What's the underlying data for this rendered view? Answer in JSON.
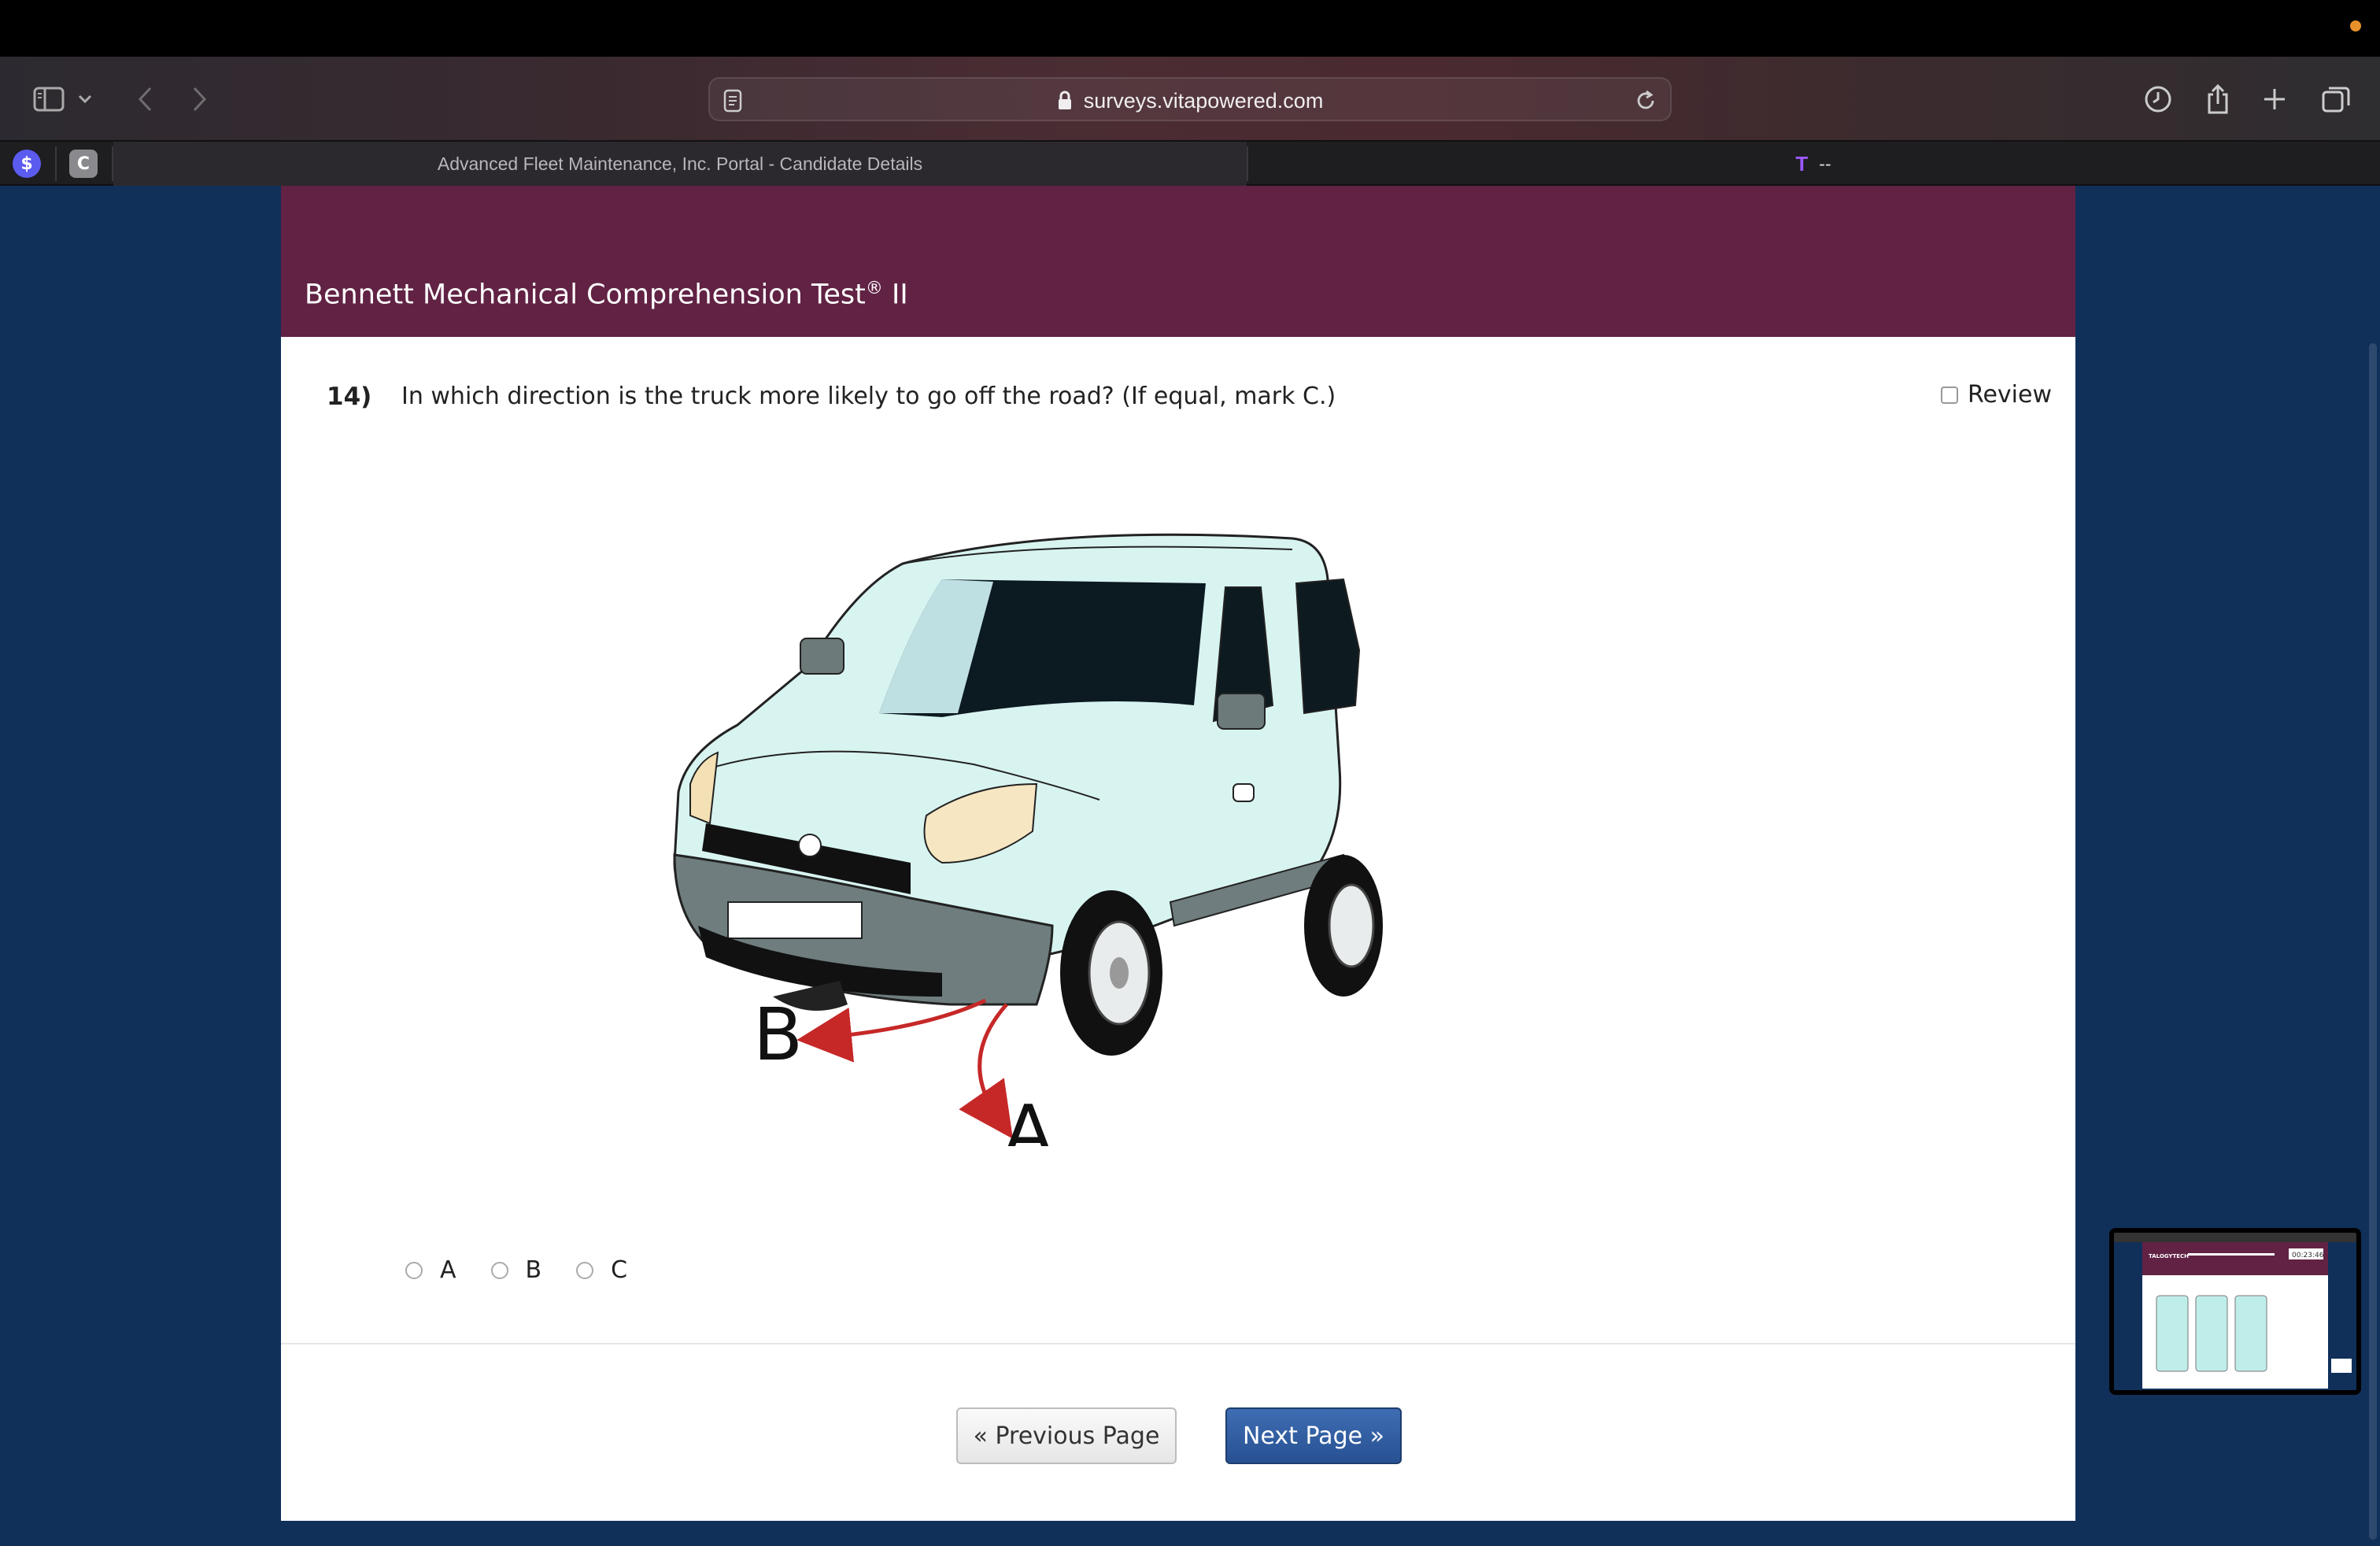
{
  "browser": {
    "url": "surveys.vitapowered.com",
    "tabs": [
      {
        "label": "Advanced Fleet Maintenance, Inc. Portal - Candidate Details",
        "active": true
      },
      {
        "label": "--",
        "active": false
      }
    ],
    "pinned": [
      {
        "glyph": "$",
        "color": "#5b5bf0"
      },
      {
        "glyph": "C",
        "color": "#8a8a8e"
      }
    ],
    "tab2_icon": "T"
  },
  "page": {
    "title": "Bennett Mechanical Comprehension Test",
    "title_sup": "®",
    "title_suffix": " II",
    "question": {
      "number": "14)",
      "text": "In which direction is the truck more likely to go off the road? (If equal, mark C.)",
      "review_label": "Review",
      "figure_labels": {
        "a": "A",
        "b": "B"
      },
      "options": [
        "A",
        "B",
        "C"
      ]
    },
    "nav": {
      "prev": "« Previous Page",
      "next": "Next Page »"
    }
  },
  "pip": {
    "logo": "TALOGYTECH",
    "timer": "00:23:46"
  },
  "colors": {
    "banner": "#612244",
    "background": "#10305a",
    "next_button": "#2f5a9c",
    "arrow": "#c62828",
    "truck_body": "#d8f4f1"
  }
}
